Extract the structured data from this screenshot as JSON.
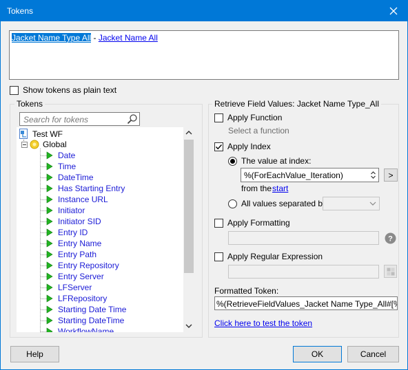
{
  "window": {
    "title": "Tokens"
  },
  "token_text": {
    "selected": "Jacket Name Type  All",
    "separator": " - ",
    "link": "Jacket Name  All"
  },
  "show_plain": {
    "label": "Show tokens as plain text",
    "checked": false
  },
  "tokens_panel": {
    "label": "Tokens",
    "search_placeholder": "Search for tokens",
    "root": "Test WF",
    "global": "Global",
    "items": [
      "Date",
      "Time",
      "DateTime",
      "Has Starting Entry",
      "Instance URL",
      "Initiator",
      "Initiator SID",
      "Entry ID",
      "Entry Name",
      "Entry Path",
      "Entry Repository",
      "Entry Server",
      "LFServer",
      "LFRepository",
      "Starting Date Time",
      "Starting DateTime",
      "WorkflowName"
    ]
  },
  "retrieve": {
    "label": "Retrieve Field Values: Jacket Name Type_All",
    "apply_function": {
      "label": "Apply Function",
      "checked": false,
      "hint": "Select a function"
    },
    "apply_index": {
      "label": "Apply Index",
      "checked": true
    },
    "value_at_index": {
      "label": "The value at index:",
      "selected": true,
      "value": "%(ForEachValue_Iteration)",
      "from_label": "from the",
      "from_link": "start",
      "arrow_button": ">"
    },
    "all_values": {
      "label": "All values separated by:",
      "selected": false,
      "value": ""
    },
    "apply_formatting": {
      "label": "Apply Formatting",
      "checked": false
    },
    "apply_regex": {
      "label": "Apply Regular Expression",
      "checked": false
    },
    "formatted_token": {
      "label": "Formatted Token:",
      "value": "%(RetrieveFieldValues_Jacket Name Type_All#[%(ForE"
    },
    "test_link": "Click here to test the token"
  },
  "buttons": {
    "help": "Help",
    "ok": "OK",
    "cancel": "Cancel"
  },
  "colors": {
    "titlebar": "#0078d7",
    "link": "#0000ee",
    "tree_text": "#1a1ad6",
    "play_icon": "#22b422"
  }
}
